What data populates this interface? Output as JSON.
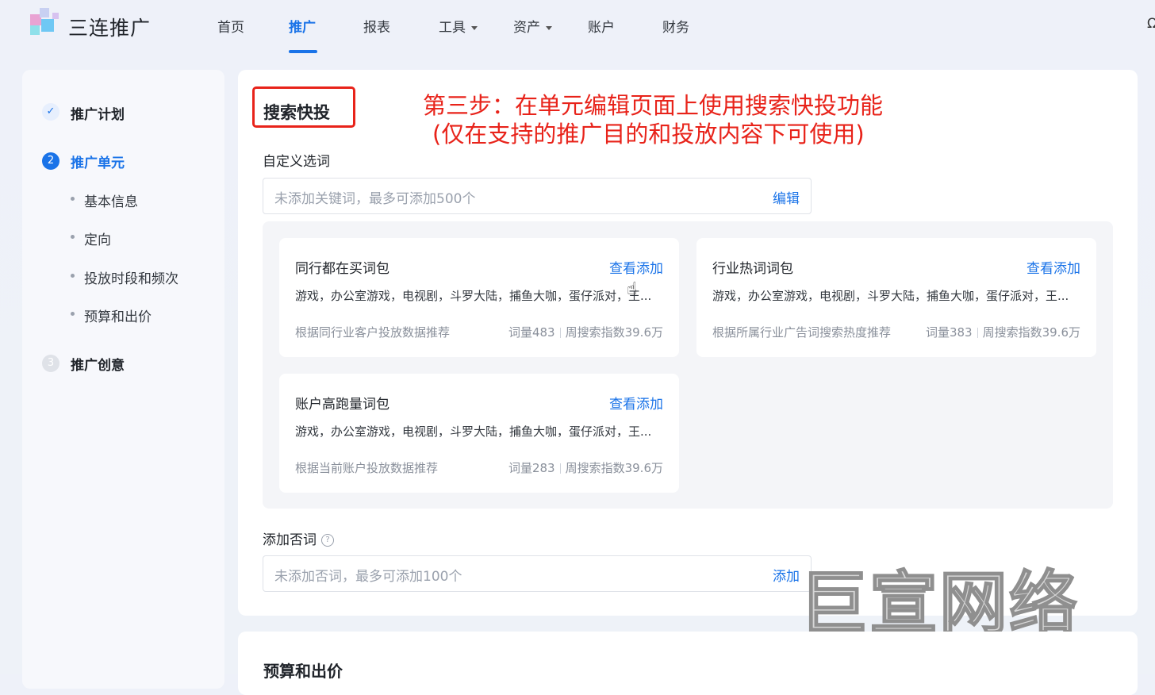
{
  "header": {
    "brand": "三连推广",
    "nav": [
      "首页",
      "推广",
      "报表",
      "工具",
      "资产",
      "账户",
      "财务"
    ],
    "active_nav": "推广",
    "right_glyph": "Ω"
  },
  "sidebar": {
    "steps": [
      {
        "index": "✓",
        "label": "推广计划",
        "state": "done"
      },
      {
        "index": "2",
        "label": "推广单元",
        "state": "active"
      },
      {
        "index": "3",
        "label": "推广创意",
        "state": "pending"
      }
    ],
    "sub_items": [
      "基本信息",
      "定向",
      "投放时段和频次",
      "预算和出价"
    ]
  },
  "main": {
    "section_title": "搜索快投",
    "annotation_line1": "第三步：在单元编辑页面上使用搜索快投功能",
    "annotation_line2": "(仅在支持的推广目的和投放内容下可使用)",
    "custom_words_label": "自定义选词",
    "custom_words_placeholder": "未添加关键词，最多可添加500个",
    "custom_words_action": "编辑",
    "cards": [
      {
        "title": "同行都在买词包",
        "link": "查看添加",
        "keywords": "游戏，办公室游戏，电视剧，斗罗大陆，捕鱼大咖，蛋仔派对，王...",
        "desc": "根据同行业客户投放数据推荐",
        "count": "词量483",
        "index": "周搜索指数39.6万"
      },
      {
        "title": "行业热词词包",
        "link": "查看添加",
        "keywords": "游戏，办公室游戏，电视剧，斗罗大陆，捕鱼大咖，蛋仔派对，王...",
        "desc": "根据所属行业广告词搜索热度推荐",
        "count": "词量383",
        "index": "周搜索指数39.6万"
      },
      {
        "title": "账户高跑量词包",
        "link": "查看添加",
        "keywords": "游戏，办公室游戏，电视剧，斗罗大陆，捕鱼大咖，蛋仔派对，王...",
        "desc": "根据当前账户投放数据推荐",
        "count": "词量283",
        "index": "周搜索指数39.6万"
      }
    ],
    "negative_label": "添加否词",
    "negative_placeholder": "未添加否词，最多可添加100个",
    "negative_action": "添加",
    "budget_title": "预算和出价"
  },
  "watermark": "巨宣网络",
  "colors": {
    "accent": "#1a73e8",
    "annotation_red": "#e8231a"
  }
}
